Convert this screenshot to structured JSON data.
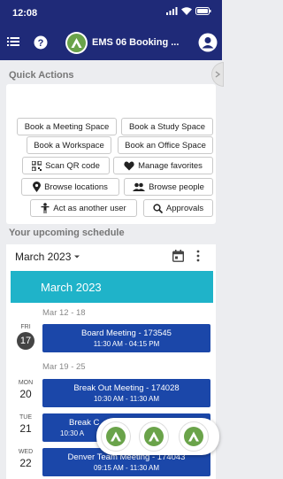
{
  "status": {
    "time": "12:08"
  },
  "header": {
    "title": "EMS 06 Booking ..."
  },
  "quick_actions": {
    "title": "Quick Actions",
    "buttons": [
      "Book a Meeting Space",
      "Book a Study Space",
      "Book a Workspace",
      "Book an Office Space",
      "Scan QR code",
      "Manage favorites",
      "Browse locations",
      "Browse people",
      "Act as another user",
      "Approvals"
    ]
  },
  "schedule": {
    "title": "Your upcoming schedule",
    "month_select": "March 2023",
    "banner": "March 2023",
    "weeks": [
      "Mar 12 - 18",
      "Mar 19 - 25"
    ],
    "days": [
      {
        "dow": "FRI",
        "num": "17"
      },
      {
        "dow": "MON",
        "num": "20"
      },
      {
        "dow": "TUE",
        "num": "21"
      },
      {
        "dow": "WED",
        "num": "22"
      }
    ],
    "events": [
      {
        "title": "Board Meeting - 173545",
        "time": "11:30 AM - 04:15 PM"
      },
      {
        "title": "Break Out Meeting - 174028",
        "time": "10:30 AM - 11:30 AM"
      },
      {
        "title": "Break C",
        "time": "10:30 A"
      },
      {
        "title": "Denver Team Meeting - 174043",
        "time": "09:15 AM - 11:30 AM"
      }
    ]
  },
  "colors": {
    "header": "#1f2a78",
    "event": "#1b47a9",
    "banner": "#1fb3c9"
  },
  "icons": [
    "menu-icon",
    "help-icon",
    "profile-icon",
    "qr-code-icon",
    "heart-icon",
    "location-pin-icon",
    "people-icon",
    "person-icon",
    "search-icon",
    "calendar-icon",
    "more-vert-icon"
  ]
}
